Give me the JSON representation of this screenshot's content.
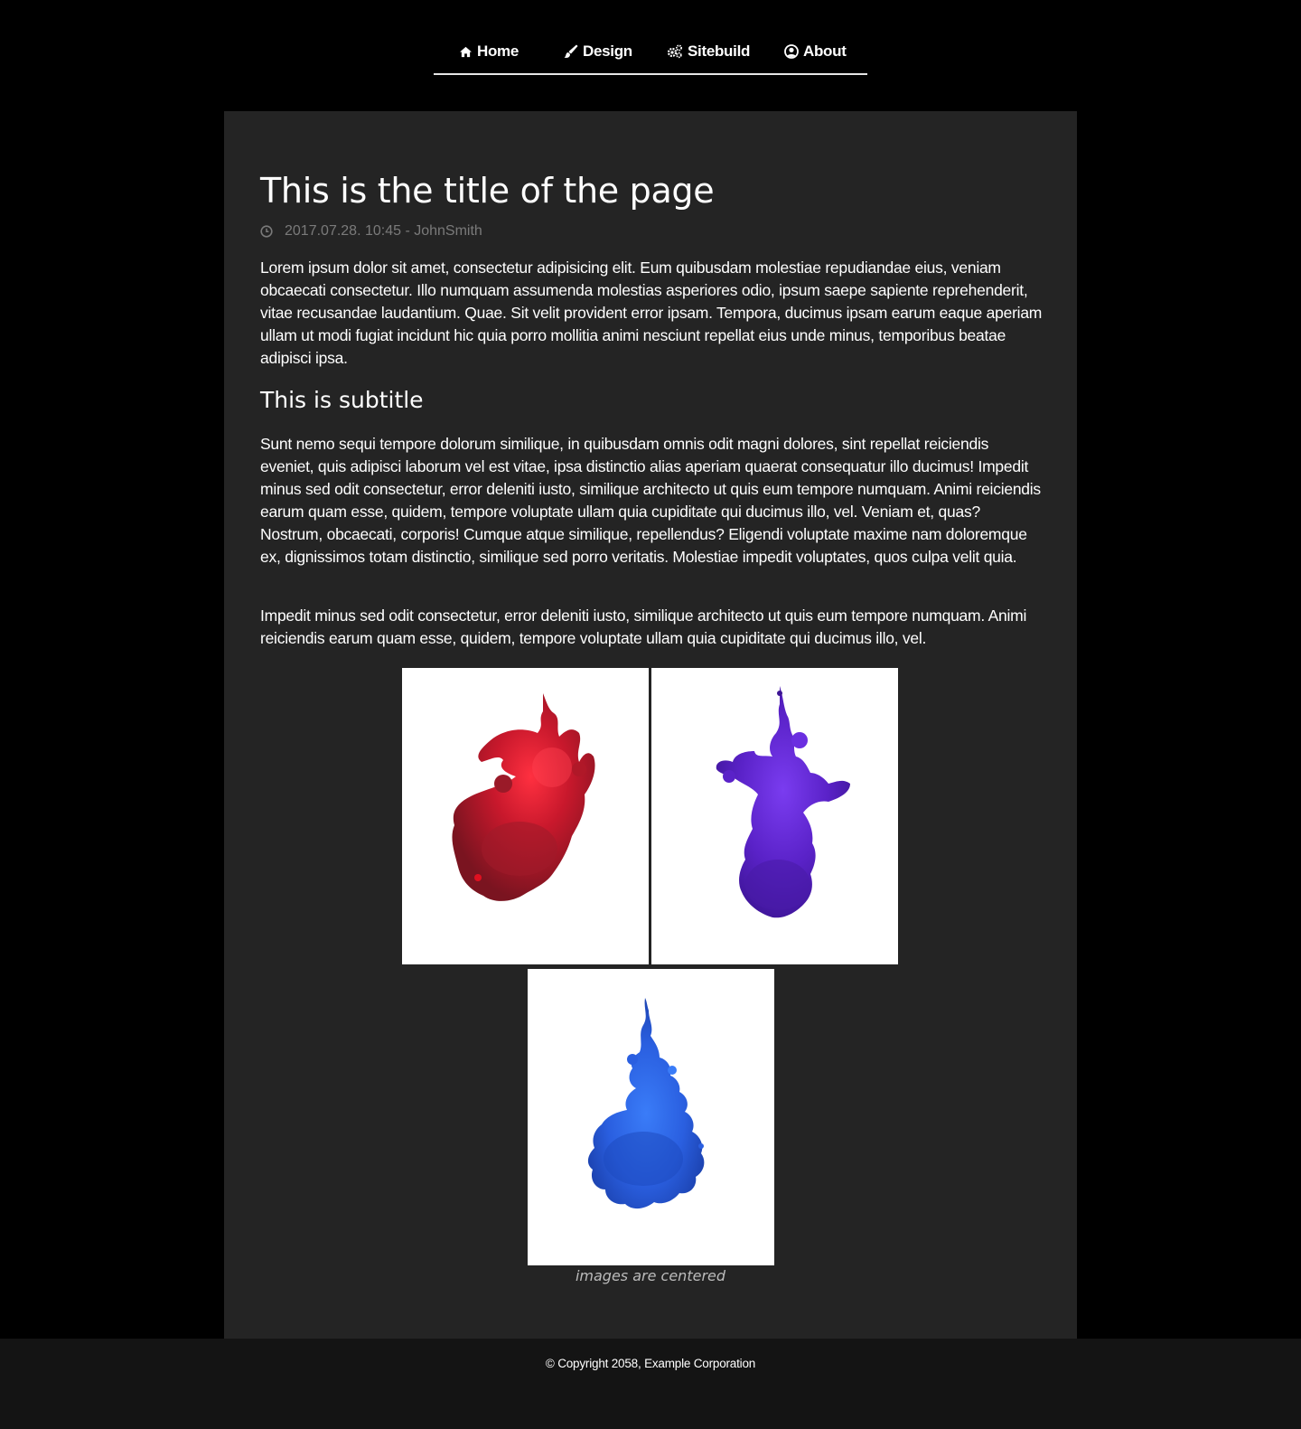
{
  "nav": {
    "items": [
      {
        "label": "Home",
        "icon": "home-icon"
      },
      {
        "label": "Design",
        "icon": "brush-icon"
      },
      {
        "label": "Sitebuild",
        "icon": "gears-icon"
      },
      {
        "label": "About",
        "icon": "user-circle-icon"
      }
    ]
  },
  "article": {
    "title": "This is the title of the page",
    "meta": "2017.07.28. 10:45 - JohnSmith",
    "meta_icon": "clock-icon",
    "paragraph_1": "Lorem ipsum dolor sit amet, consectetur adipisicing elit. Eum quibusdam molestiae repudiandae eius, veniam obcaecati consectetur. Illo numquam assumenda molestias asperiores odio, ipsum saepe sapiente reprehenderit, vitae recusandae laudantium. Quae. Sit velit provident error ipsam. Tempora, ducimus ipsam earum eaque aperiam ullam ut modi fugiat incidunt hic quia porro mollitia animi nesciunt repellat eius unde minus, temporibus beatae adipisci ipsa.",
    "subtitle": "This is subtitle",
    "paragraph_2": "Sunt nemo sequi tempore dolorum similique, in quibusdam omnis odit magni dolores, sint repellat reiciendis eveniet, quis adipisci laborum vel est vitae, ipsa distinctio alias aperiam quaerat consequatur illo ducimus! Impedit minus sed odit consectetur, error deleniti iusto, similique architecto ut quis eum tempore numquam. Animi reiciendis earum quam esse, quidem, tempore voluptate ullam quia cupiditate qui ducimus illo, vel. Veniam et, quas? Nostrum, obcaecati, corporis! Cumque atque similique, repellendus? Eligendi voluptate maxime nam doloremque ex, dignissimos totam distinctio, similique sed porro veritatis. Molestiae impedit voluptates, quos culpa velit quia.",
    "paragraph_3": "Impedit minus sed odit consectetur, error deleniti iusto, similique architecto ut quis eum tempore numquam. Animi reiciendis earum quam esse, quidem, tempore voluptate ullam quia cupiditate qui ducimus illo, vel.",
    "images": [
      {
        "name": "red-ink-image",
        "color": "#b0182c"
      },
      {
        "name": "purple-ink-image",
        "color": "#5a22c8"
      },
      {
        "name": "blue-ink-image",
        "color": "#2a5fe0"
      }
    ],
    "caption": "images are centered"
  },
  "footer": {
    "copyright": "© Copyright 2058, Example Corporation"
  },
  "colors": {
    "page_bg": "#000000",
    "content_bg": "#242424",
    "footer_bg": "#141414",
    "meta_text": "#7a7a7a"
  }
}
